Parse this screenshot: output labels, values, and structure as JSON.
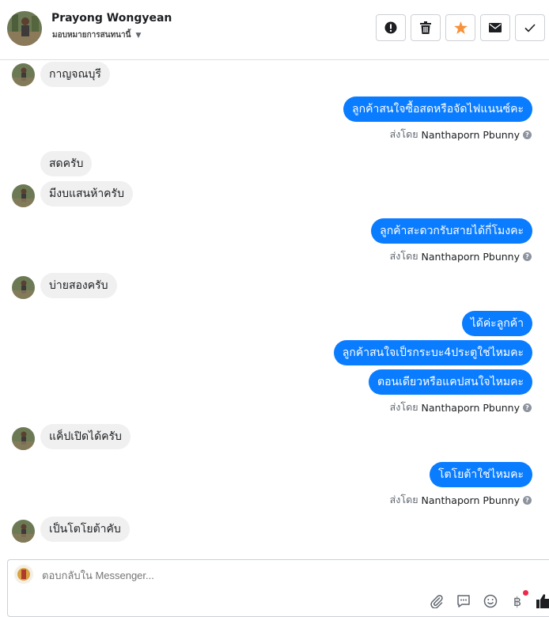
{
  "contact": {
    "name": "Prayong Wongyean",
    "assignment": "มอบหมายการสนทนานี้"
  },
  "actions": [
    "report-icon",
    "delete-icon",
    "star-icon",
    "mail-icon",
    "check-icon"
  ],
  "colors": {
    "outgoing_bubble": "#0a7cff",
    "incoming_bubble": "#f0f0f0",
    "star": "#f7923b",
    "accent": "#0a7cff"
  },
  "messages": [
    {
      "dir": "in",
      "text": "กาญจณบุรี"
    },
    {
      "dir": "out",
      "text": "ลูกค้าสนใจซื้อสดหรือจัดไฟแนนซ์คะ"
    },
    {
      "dir": "in",
      "text": "สดครับ"
    },
    {
      "dir": "in",
      "text": "มีงบแสนห้าครับ"
    },
    {
      "dir": "out",
      "text": "ลูกค้าสะดวกรับสายได้กี่โมงคะ"
    },
    {
      "dir": "in",
      "text": "บ่ายสองครับ"
    },
    {
      "dir": "out",
      "text": "ได้ค่ะลูกค้า"
    },
    {
      "dir": "out",
      "text": "ลูกค้าสนใจเป็รกระบะ4ประตูใช่ไหมคะ"
    },
    {
      "dir": "out",
      "text": "ตอนเดียวหรือแคปสนใจไหมคะ"
    },
    {
      "dir": "in",
      "text": "แค็ปเปิดได้ครับ"
    },
    {
      "dir": "out",
      "text": "โตโยต้าใช่ไหมคะ"
    },
    {
      "dir": "in",
      "text": "เป็นโตโยต้าคับ"
    }
  ],
  "sent_by": {
    "prefix": "ส่งโดย",
    "name": "Nanthaporn Pbunny"
  },
  "composer": {
    "placeholder": "ตอบกลับใน Messenger...",
    "tools": [
      "attach-icon",
      "saved-reply-icon",
      "emoji-icon",
      "payment-icon",
      "like-icon"
    ],
    "payment_symbol": "฿"
  }
}
